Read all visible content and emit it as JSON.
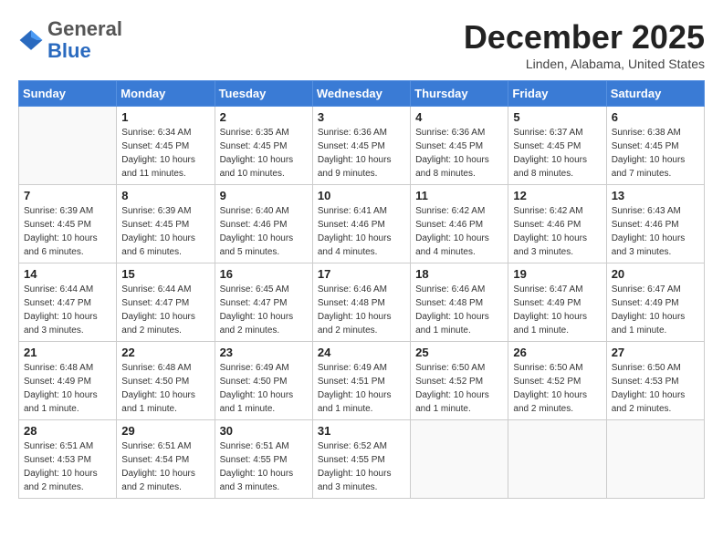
{
  "header": {
    "logo_line1": "General",
    "logo_line2": "Blue",
    "title": "December 2025",
    "subtitle": "Linden, Alabama, United States"
  },
  "weekdays": [
    "Sunday",
    "Monday",
    "Tuesday",
    "Wednesday",
    "Thursday",
    "Friday",
    "Saturday"
  ],
  "weeks": [
    [
      {
        "day": "",
        "info": ""
      },
      {
        "day": "1",
        "info": "Sunrise: 6:34 AM\nSunset: 4:45 PM\nDaylight: 10 hours\nand 11 minutes."
      },
      {
        "day": "2",
        "info": "Sunrise: 6:35 AM\nSunset: 4:45 PM\nDaylight: 10 hours\nand 10 minutes."
      },
      {
        "day": "3",
        "info": "Sunrise: 6:36 AM\nSunset: 4:45 PM\nDaylight: 10 hours\nand 9 minutes."
      },
      {
        "day": "4",
        "info": "Sunrise: 6:36 AM\nSunset: 4:45 PM\nDaylight: 10 hours\nand 8 minutes."
      },
      {
        "day": "5",
        "info": "Sunrise: 6:37 AM\nSunset: 4:45 PM\nDaylight: 10 hours\nand 8 minutes."
      },
      {
        "day": "6",
        "info": "Sunrise: 6:38 AM\nSunset: 4:45 PM\nDaylight: 10 hours\nand 7 minutes."
      }
    ],
    [
      {
        "day": "7",
        "info": "Sunrise: 6:39 AM\nSunset: 4:45 PM\nDaylight: 10 hours\nand 6 minutes."
      },
      {
        "day": "8",
        "info": "Sunrise: 6:39 AM\nSunset: 4:45 PM\nDaylight: 10 hours\nand 6 minutes."
      },
      {
        "day": "9",
        "info": "Sunrise: 6:40 AM\nSunset: 4:46 PM\nDaylight: 10 hours\nand 5 minutes."
      },
      {
        "day": "10",
        "info": "Sunrise: 6:41 AM\nSunset: 4:46 PM\nDaylight: 10 hours\nand 4 minutes."
      },
      {
        "day": "11",
        "info": "Sunrise: 6:42 AM\nSunset: 4:46 PM\nDaylight: 10 hours\nand 4 minutes."
      },
      {
        "day": "12",
        "info": "Sunrise: 6:42 AM\nSunset: 4:46 PM\nDaylight: 10 hours\nand 3 minutes."
      },
      {
        "day": "13",
        "info": "Sunrise: 6:43 AM\nSunset: 4:46 PM\nDaylight: 10 hours\nand 3 minutes."
      }
    ],
    [
      {
        "day": "14",
        "info": "Sunrise: 6:44 AM\nSunset: 4:47 PM\nDaylight: 10 hours\nand 3 minutes."
      },
      {
        "day": "15",
        "info": "Sunrise: 6:44 AM\nSunset: 4:47 PM\nDaylight: 10 hours\nand 2 minutes."
      },
      {
        "day": "16",
        "info": "Sunrise: 6:45 AM\nSunset: 4:47 PM\nDaylight: 10 hours\nand 2 minutes."
      },
      {
        "day": "17",
        "info": "Sunrise: 6:46 AM\nSunset: 4:48 PM\nDaylight: 10 hours\nand 2 minutes."
      },
      {
        "day": "18",
        "info": "Sunrise: 6:46 AM\nSunset: 4:48 PM\nDaylight: 10 hours\nand 1 minute."
      },
      {
        "day": "19",
        "info": "Sunrise: 6:47 AM\nSunset: 4:49 PM\nDaylight: 10 hours\nand 1 minute."
      },
      {
        "day": "20",
        "info": "Sunrise: 6:47 AM\nSunset: 4:49 PM\nDaylight: 10 hours\nand 1 minute."
      }
    ],
    [
      {
        "day": "21",
        "info": "Sunrise: 6:48 AM\nSunset: 4:49 PM\nDaylight: 10 hours\nand 1 minute."
      },
      {
        "day": "22",
        "info": "Sunrise: 6:48 AM\nSunset: 4:50 PM\nDaylight: 10 hours\nand 1 minute."
      },
      {
        "day": "23",
        "info": "Sunrise: 6:49 AM\nSunset: 4:50 PM\nDaylight: 10 hours\nand 1 minute."
      },
      {
        "day": "24",
        "info": "Sunrise: 6:49 AM\nSunset: 4:51 PM\nDaylight: 10 hours\nand 1 minute."
      },
      {
        "day": "25",
        "info": "Sunrise: 6:50 AM\nSunset: 4:52 PM\nDaylight: 10 hours\nand 1 minute."
      },
      {
        "day": "26",
        "info": "Sunrise: 6:50 AM\nSunset: 4:52 PM\nDaylight: 10 hours\nand 2 minutes."
      },
      {
        "day": "27",
        "info": "Sunrise: 6:50 AM\nSunset: 4:53 PM\nDaylight: 10 hours\nand 2 minutes."
      }
    ],
    [
      {
        "day": "28",
        "info": "Sunrise: 6:51 AM\nSunset: 4:53 PM\nDaylight: 10 hours\nand 2 minutes."
      },
      {
        "day": "29",
        "info": "Sunrise: 6:51 AM\nSunset: 4:54 PM\nDaylight: 10 hours\nand 2 minutes."
      },
      {
        "day": "30",
        "info": "Sunrise: 6:51 AM\nSunset: 4:55 PM\nDaylight: 10 hours\nand 3 minutes."
      },
      {
        "day": "31",
        "info": "Sunrise: 6:52 AM\nSunset: 4:55 PM\nDaylight: 10 hours\nand 3 minutes."
      },
      {
        "day": "",
        "info": ""
      },
      {
        "day": "",
        "info": ""
      },
      {
        "day": "",
        "info": ""
      }
    ]
  ]
}
